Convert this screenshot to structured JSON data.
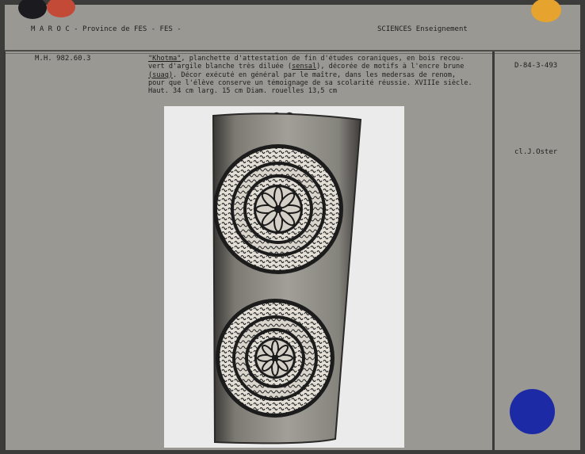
{
  "header": {
    "location": "M A R O C  - Province de FES  -  FES -",
    "category": "SCIENCES  Enseignement"
  },
  "inventory": "M.H. 982.60.3",
  "neg_number": "D-84-3-493",
  "credit": "cl.J.Oster",
  "description": {
    "l1_a": "\"Khotma\"",
    "l1_b": ", planchette d'attestation de fin d'études coraniques, en bois recou-",
    "l2_a": "vert d'argile blanche très diluée (",
    "l2_u": "sensal",
    "l2_b": "), décorée de motifs à l'encre brune",
    "l3_u": "(suaq)",
    "l3_b": ". Décor exécuté en général par le maître, dans les medersas de renom,",
    "l4": "pour que l'élève conserve un témoignage de sa scolarité réussie. XVIIIe siècle.",
    "l5": "Haut. 34 cm larg. 15 cm  Diam. rouelles  13,5 cm"
  },
  "colors": {
    "card": "#9a9893",
    "dot_black": "#1b1b1f",
    "dot_red": "#c24a36",
    "dot_orange": "#e6a32e",
    "dot_blue": "#1d2aa6"
  }
}
